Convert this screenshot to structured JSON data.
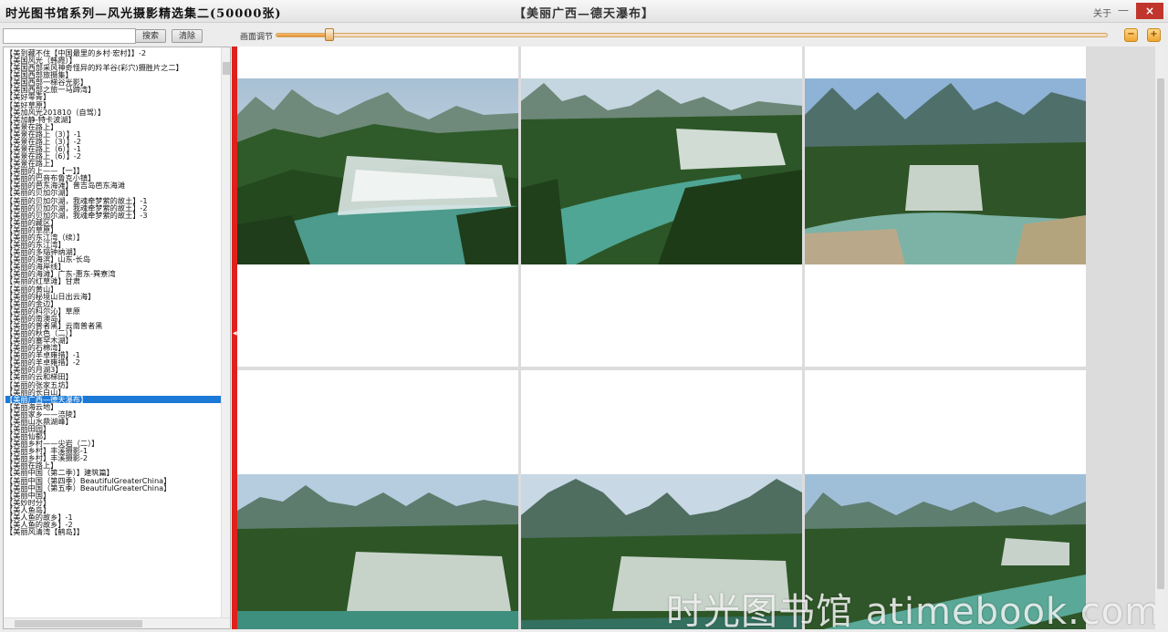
{
  "window": {
    "app_title": "时光图书馆系列—风光摄影精选集二(50000张)",
    "collection_title": "【美丽广西—德天瀑布】",
    "about_label": "关于",
    "minimize_label": "—",
    "close_label": "×"
  },
  "toolbar": {
    "search_placeholder": "",
    "search_value": "",
    "search_button": "搜索",
    "clear_button": "清除",
    "zoom_label": "画面调节",
    "zoom_level": 0.065,
    "zoom_out_label": "−",
    "zoom_in_label": "+"
  },
  "list": {
    "selected_index": 54,
    "items": [
      "【美到藏不住【中国最里的乡村·宏村】】-2",
      "【美国风光（韩霞）】",
      "【美国西部采风神奇怪异的羚羊谷(彩穴)摄胜片之二】",
      "【美国西部旅摄集】",
      "【美国西部一梯谷光影】",
      "【美国西部之旅一马蹄湾】",
      "【美好零青】",
      "【美好草原】",
      "【美加风光201810（自驾）】",
      "【美加静-特卡波湖】",
      "【美景在路上】",
      "【美景在路上（3）】-1",
      "【美景在路上（3）】-2",
      "【美景在路上（6）】-1",
      "【美景在路上（6）】-2",
      "【美景在路上】",
      "【美丽的上——【一】】",
      "【美丽的巴音布鲁克小镇】",
      "【美丽的芭东海滩】普吉岛芭东海滩",
      "【美丽的贝加尔湖】",
      "【美丽的贝加尔湖，我魂牵梦萦的故土】-1",
      "【美丽的贝加尔湖，我魂牵梦萦的故土】-2",
      "【美丽的贝加尔湖，我魂牵梦萦的故土】-3",
      "【美丽的藏区】",
      "【美丽的草原】",
      "【美丽的东江湾（续）】",
      "【美丽的东江湾】",
      "【美丽的多瑙钟纳湖】",
      "【美丽的海滨】山东-长岛",
      "【美丽的海岸线】",
      "【美丽的海滩】广东-惠东-巽寮湾",
      "【美丽的红草滩】甘肃",
      "【美丽的黄山】",
      "【美丽的秘境山日出云海】",
      "【美丽的金边】",
      "【美丽的科尔沁】草原",
      "【美丽的南澳岛】",
      "【美丽的普者黑】云南普者黑",
      "【美丽的秋色（二）】",
      "【美丽的塞罕木湖】",
      "【美丽的石棉湾】",
      "【美丽的羊卓雍措】-1",
      "【美丽的羊卓雍措】-2",
      "【美丽的月湖3】",
      "【美丽的云和梯田】",
      "【美丽的张家五坊】",
      "【美丽的长白山】",
      "【美丽广西—德天瀑布】",
      "【美丽海云地】",
      "【美丽家乡——涪陵】",
      "【美丽山水鼎湖峰】",
      "【美丽田园】",
      "【美丽仙都】",
      "【美丽乡村——尖岩（二）】",
      "【美丽乡村】丰溪摄影-1",
      "【美丽乡村】丰溪摄影-2",
      "【美丽在路上】",
      "【美丽中国（第二季）】建筑篇】",
      "【美丽中国（第四季）BeautifulGreaterChina】",
      "【美丽中国（第五季）BeautifulGreaterChina】",
      "【美丽中国】",
      "【美妙时分】",
      "【美人鱼岛】",
      "【美人鱼的故乡】-1",
      "【美人鱼的故乡】-2",
      "【美丽风清湾【鹤岛】】"
    ]
  },
  "gallery": {
    "watermark": "时光图书馆 atimebook.com"
  }
}
